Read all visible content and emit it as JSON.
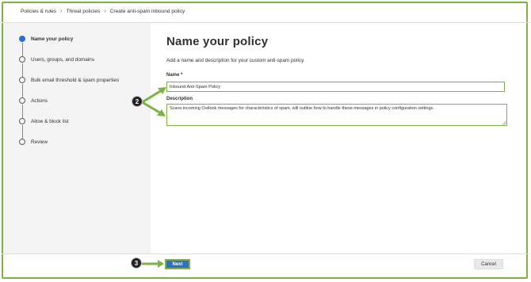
{
  "breadcrumb": [
    "Policies & rules",
    "Threat policies",
    "Create anti-spam inbound policy"
  ],
  "steps": [
    {
      "label": "Name your policy",
      "active": true
    },
    {
      "label": "Users, groups, and domains",
      "active": false
    },
    {
      "label": "Bulk email threshold & spam properties",
      "active": false
    },
    {
      "label": "Actions",
      "active": false
    },
    {
      "label": "Allow & block list",
      "active": false
    },
    {
      "label": "Review",
      "active": false
    }
  ],
  "main": {
    "title": "Name your policy",
    "description": "Add a name and description for your custom anti-spam policy.",
    "name_label": "Name *",
    "name_value": "Inbound Anti-Spam Policy",
    "description_label": "Description",
    "description_value": "Scans incoming Outlook messages for characteristics of spam, will outline how to handle these messages in policy configuration settings."
  },
  "footer": {
    "next_label": "Next",
    "cancel_label": "Cancel"
  },
  "callouts": {
    "name_callout": "2",
    "next_callout": "3"
  },
  "colors": {
    "highlight": "#7cb342",
    "primary": "#2f6fbf",
    "active_step": "#2b6fd6"
  }
}
